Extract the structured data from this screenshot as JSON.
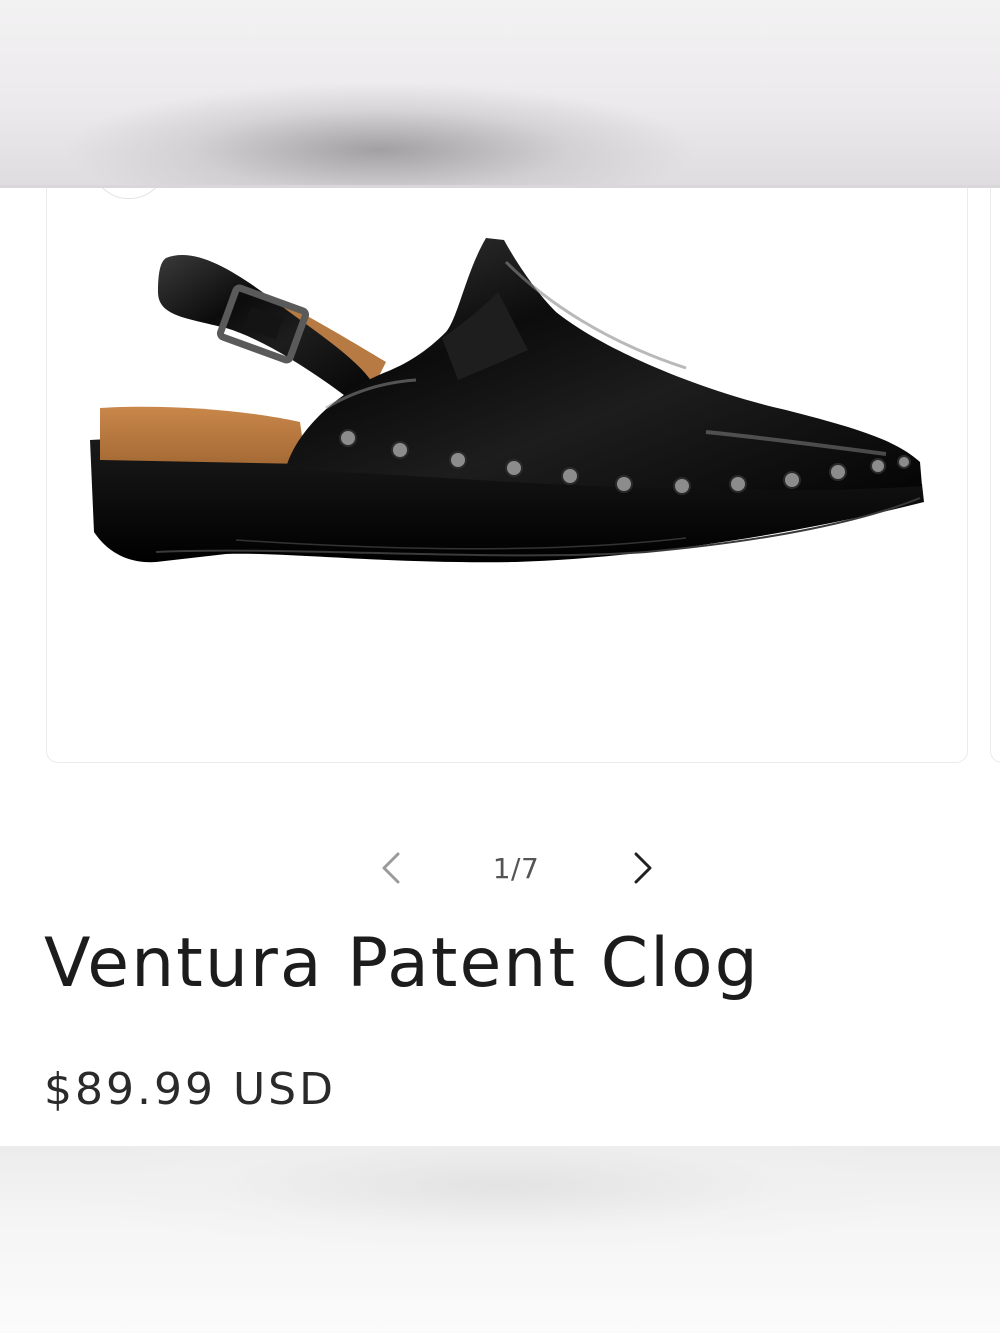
{
  "gallery": {
    "counter": "1/7",
    "prev_icon": "chevron-left-icon",
    "next_icon": "chevron-right-icon",
    "zoom_icon": "zoom-icon"
  },
  "product": {
    "title": "Ventura Patent Clog",
    "price": "$89.99 USD",
    "image_alt": "black-patent-clog-image"
  },
  "colors": {
    "text": "#222222",
    "chevron": "#555555",
    "card_border": "#ebebeb"
  }
}
